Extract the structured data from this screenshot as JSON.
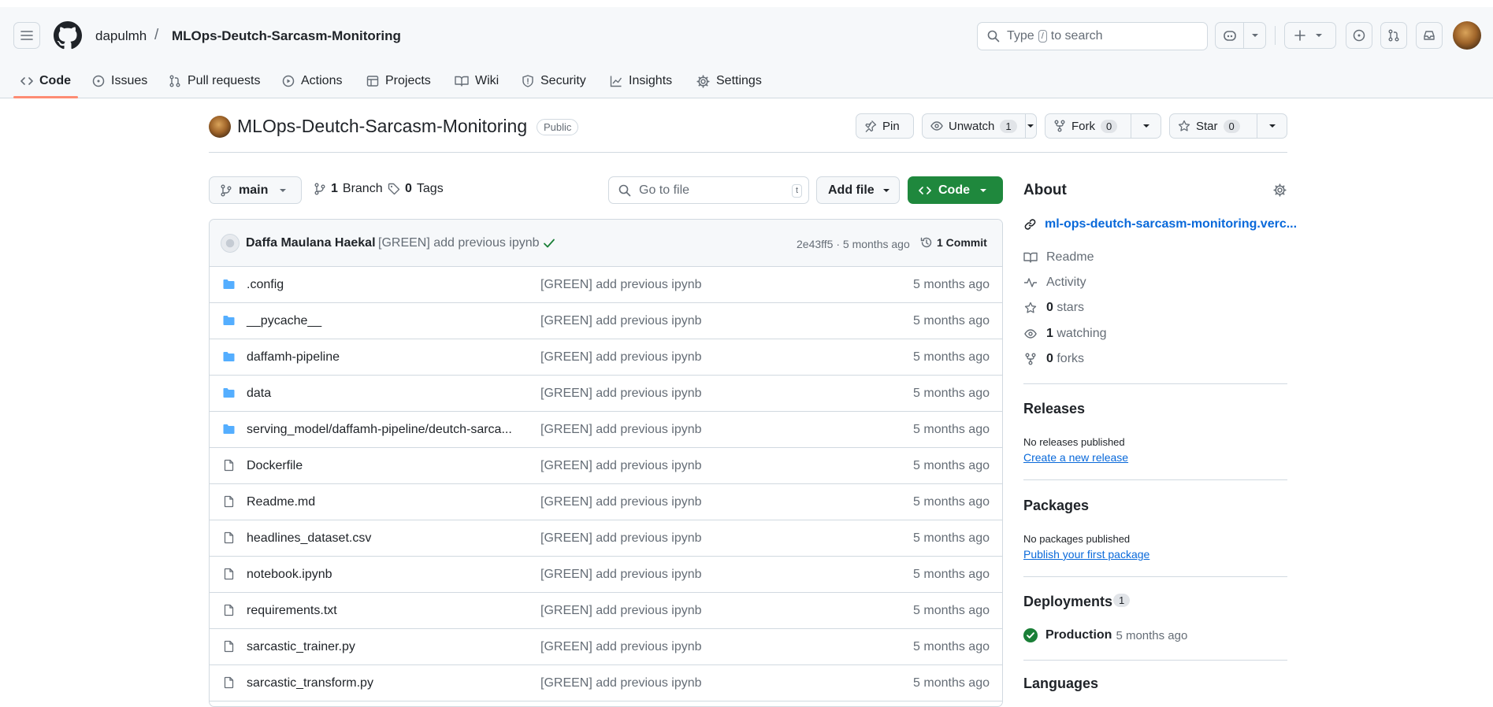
{
  "header": {
    "owner": "dapulmh",
    "repo": "MLOps-Deutch-Sarcasm-Monitoring",
    "search_prefix": "Type",
    "search_key": "/",
    "search_suffix": "to search"
  },
  "tabs": [
    {
      "label": "Code",
      "icon": "code-icon"
    },
    {
      "label": "Issues",
      "icon": "issue-icon"
    },
    {
      "label": "Pull requests",
      "icon": "pull-request-icon"
    },
    {
      "label": "Actions",
      "icon": "play-icon"
    },
    {
      "label": "Projects",
      "icon": "table-icon"
    },
    {
      "label": "Wiki",
      "icon": "book-icon"
    },
    {
      "label": "Security",
      "icon": "shield-icon"
    },
    {
      "label": "Insights",
      "icon": "graph-icon"
    },
    {
      "label": "Settings",
      "icon": "gear-icon"
    }
  ],
  "repo_header": {
    "title": "MLOps-Deutch-Sarcasm-Monitoring",
    "visibility": "Public",
    "pin": "Pin",
    "unwatch": "Unwatch",
    "watch_count": "1",
    "fork": "Fork",
    "fork_count": "0",
    "star": "Star",
    "star_count": "0"
  },
  "toolbar": {
    "branch": "main",
    "branch_count": "1",
    "branch_label": "Branch",
    "tag_count": "0",
    "tag_label": "Tags",
    "go_to_file": "Go to file",
    "go_to_file_key": "t",
    "add_file": "Add file",
    "code": "Code"
  },
  "commit": {
    "author": "Daffa Maulana Haekal",
    "message": "[GREEN] add previous ipynb",
    "hash_time": "2e43ff5 · 5 months ago",
    "count_label": "1 Commit"
  },
  "files": [
    {
      "name": ".config",
      "type": "folder",
      "message": "[GREEN] add previous ipynb",
      "date": "5 months ago"
    },
    {
      "name": "__pycache__",
      "type": "folder",
      "message": "[GREEN] add previous ipynb",
      "date": "5 months ago"
    },
    {
      "name": "daffamh-pipeline",
      "type": "folder",
      "message": "[GREEN] add previous ipynb",
      "date": "5 months ago"
    },
    {
      "name": "data",
      "type": "folder",
      "message": "[GREEN] add previous ipynb",
      "date": "5 months ago"
    },
    {
      "name": "serving_model/daffamh-pipeline/deutch-sarca...",
      "type": "folder",
      "message": "[GREEN] add previous ipynb",
      "date": "5 months ago"
    },
    {
      "name": "Dockerfile",
      "type": "file",
      "message": "[GREEN] add previous ipynb",
      "date": "5 months ago"
    },
    {
      "name": "Readme.md",
      "type": "file",
      "message": "[GREEN] add previous ipynb",
      "date": "5 months ago"
    },
    {
      "name": "headlines_dataset.csv",
      "type": "file",
      "message": "[GREEN] add previous ipynb",
      "date": "5 months ago"
    },
    {
      "name": "notebook.ipynb",
      "type": "file",
      "message": "[GREEN] add previous ipynb",
      "date": "5 months ago"
    },
    {
      "name": "requirements.txt",
      "type": "file",
      "message": "[GREEN] add previous ipynb",
      "date": "5 months ago"
    },
    {
      "name": "sarcastic_trainer.py",
      "type": "file",
      "message": "[GREEN] add previous ipynb",
      "date": "5 months ago"
    },
    {
      "name": "sarcastic_transform.py",
      "type": "file",
      "message": "[GREEN] add previous ipynb",
      "date": "5 months ago"
    }
  ],
  "about": {
    "title": "About",
    "link": "ml-ops-deutch-sarcasm-monitoring.verc...",
    "readme": "Readme",
    "activity": "Activity",
    "stars_count": "0",
    "stars_label": "stars",
    "watching_count": "1",
    "watching_label": "watching",
    "forks_count": "0",
    "forks_label": "forks"
  },
  "releases": {
    "title": "Releases",
    "none": "No releases published",
    "create": "Create a new release"
  },
  "packages": {
    "title": "Packages",
    "none": "No packages published",
    "publish": "Publish your first package"
  },
  "deployments": {
    "title": "Deployments",
    "count": "1",
    "env": "Production",
    "time": "5 months ago"
  },
  "languages": {
    "title": "Languages"
  },
  "colors": {
    "accent_blue": "#0969da",
    "code_green": "#1f883d",
    "tab_underline": "#fd8c73",
    "folder_blue": "#54aeff"
  }
}
